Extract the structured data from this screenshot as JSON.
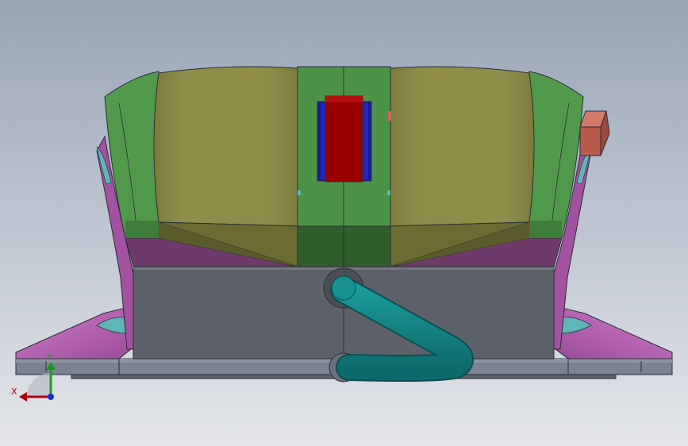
{
  "viewport": {
    "background_top": "#9aa6b8",
    "background_bottom": "#e2e5ea"
  },
  "triad": {
    "x_label": "X",
    "y_label": "Y",
    "x_color": "#b0000c",
    "y_color": "#1a9a1a",
    "z_color": "#1a2fd0"
  },
  "model": {
    "name": "",
    "colors": {
      "green_body": "#4f9a4a",
      "olive_pad": "#8c8c48",
      "magenta_flange": "#b460b0",
      "gray_base": "#60646c",
      "teal_pipe": "#127f7f",
      "red_block": "#9a0000",
      "blue_slot": "#1a1a9a",
      "salmon_knob": "#c96a5a"
    }
  }
}
